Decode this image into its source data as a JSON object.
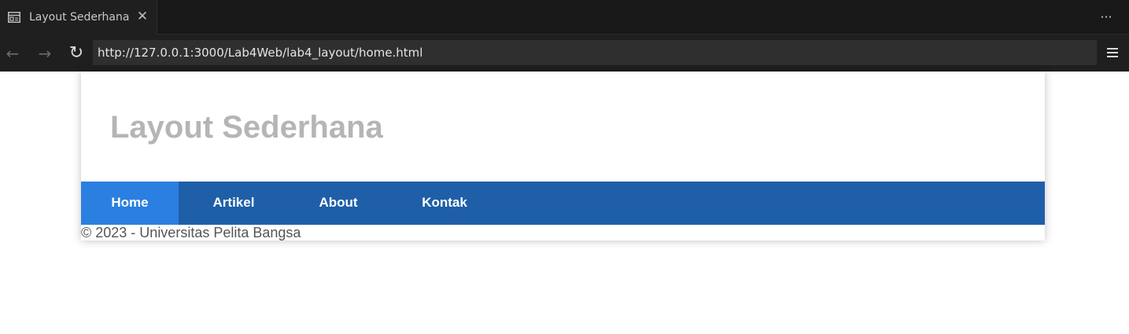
{
  "browser": {
    "tab": {
      "title": "Layout Sederhana",
      "icon": "page-layout-icon",
      "close_glyph": "✕"
    },
    "more_glyph": "···",
    "nav": {
      "back_glyph": "←",
      "forward_glyph": "→",
      "reload_glyph": "↻"
    },
    "url": "http://127.0.0.1:3000/Lab4Web/lab4_layout/home.html",
    "menu_icon": "hamburger-menu-icon"
  },
  "page": {
    "title": "Layout Sederhana",
    "nav_items": [
      {
        "label": "Home",
        "active": true
      },
      {
        "label": "Artikel",
        "active": false
      },
      {
        "label": "About",
        "active": false
      },
      {
        "label": "Kontak",
        "active": false
      }
    ],
    "footer": "© 2023 - Universitas Pelita Bangsa",
    "colors": {
      "nav_background": "#1f5fa8",
      "nav_active": "#2b7fe0",
      "title": "#b5b5b5"
    }
  }
}
